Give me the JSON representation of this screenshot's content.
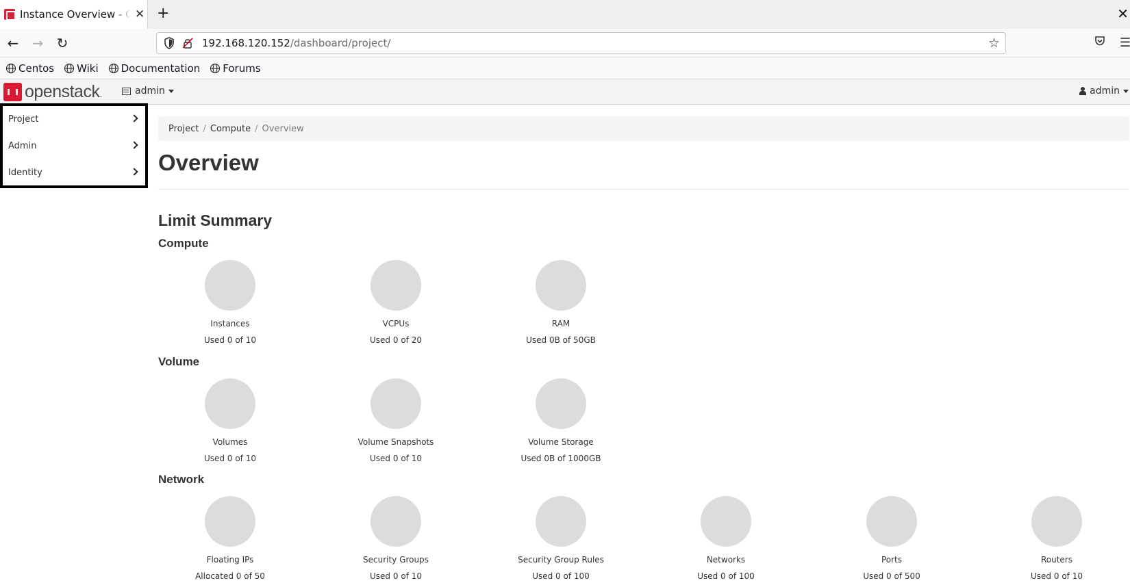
{
  "browser": {
    "tab_title": "Instance Overview - OpenStack Dashboard",
    "url_host": "192.168.120.152",
    "url_path": "/dashboard/project/",
    "bookmarks": [
      "Centos",
      "Wiki",
      "Documentation",
      "Forums"
    ]
  },
  "header": {
    "logo_text": "openstack",
    "project_selector": "admin",
    "user_menu": "admin"
  },
  "sidebar": {
    "items": [
      {
        "label": "Project"
      },
      {
        "label": "Admin"
      },
      {
        "label": "Identity"
      }
    ]
  },
  "main": {
    "breadcrumb": [
      "Project",
      "Compute",
      "Overview"
    ],
    "page_title": "Overview",
    "limit_summary_title": "Limit Summary",
    "sections": [
      {
        "title": "Compute",
        "charts": [
          {
            "label": "Instances",
            "usage": "Used 0 of 10",
            "used": 0,
            "limit": 10
          },
          {
            "label": "VCPUs",
            "usage": "Used 0 of 20",
            "used": 0,
            "limit": 20
          },
          {
            "label": "RAM",
            "usage": "Used 0B of 50GB",
            "used": 0,
            "limit": 50
          }
        ]
      },
      {
        "title": "Volume",
        "charts": [
          {
            "label": "Volumes",
            "usage": "Used 0 of 10",
            "used": 0,
            "limit": 10
          },
          {
            "label": "Volume Snapshots",
            "usage": "Used 0 of 10",
            "used": 0,
            "limit": 10
          },
          {
            "label": "Volume Storage",
            "usage": "Used 0B of 1000GB",
            "used": 0,
            "limit": 1000
          }
        ]
      },
      {
        "title": "Network",
        "charts": [
          {
            "label": "Floating IPs",
            "usage": "Allocated 0 of 50",
            "used": 0,
            "limit": 50
          },
          {
            "label": "Security Groups",
            "usage": "Used 0 of 10",
            "used": 0,
            "limit": 10
          },
          {
            "label": "Security Group Rules",
            "usage": "Used 0 of 100",
            "used": 0,
            "limit": 100
          },
          {
            "label": "Networks",
            "usage": "Used 0 of 100",
            "used": 0,
            "limit": 100
          },
          {
            "label": "Ports",
            "usage": "Used 0 of 500",
            "used": 0,
            "limit": 500
          },
          {
            "label": "Routers",
            "usage": "Used 0 of 10",
            "used": 0,
            "limit": 10
          }
        ]
      }
    ]
  },
  "colors": {
    "brand_red": "#da1a32",
    "pie_empty": "#dcdcdc"
  }
}
